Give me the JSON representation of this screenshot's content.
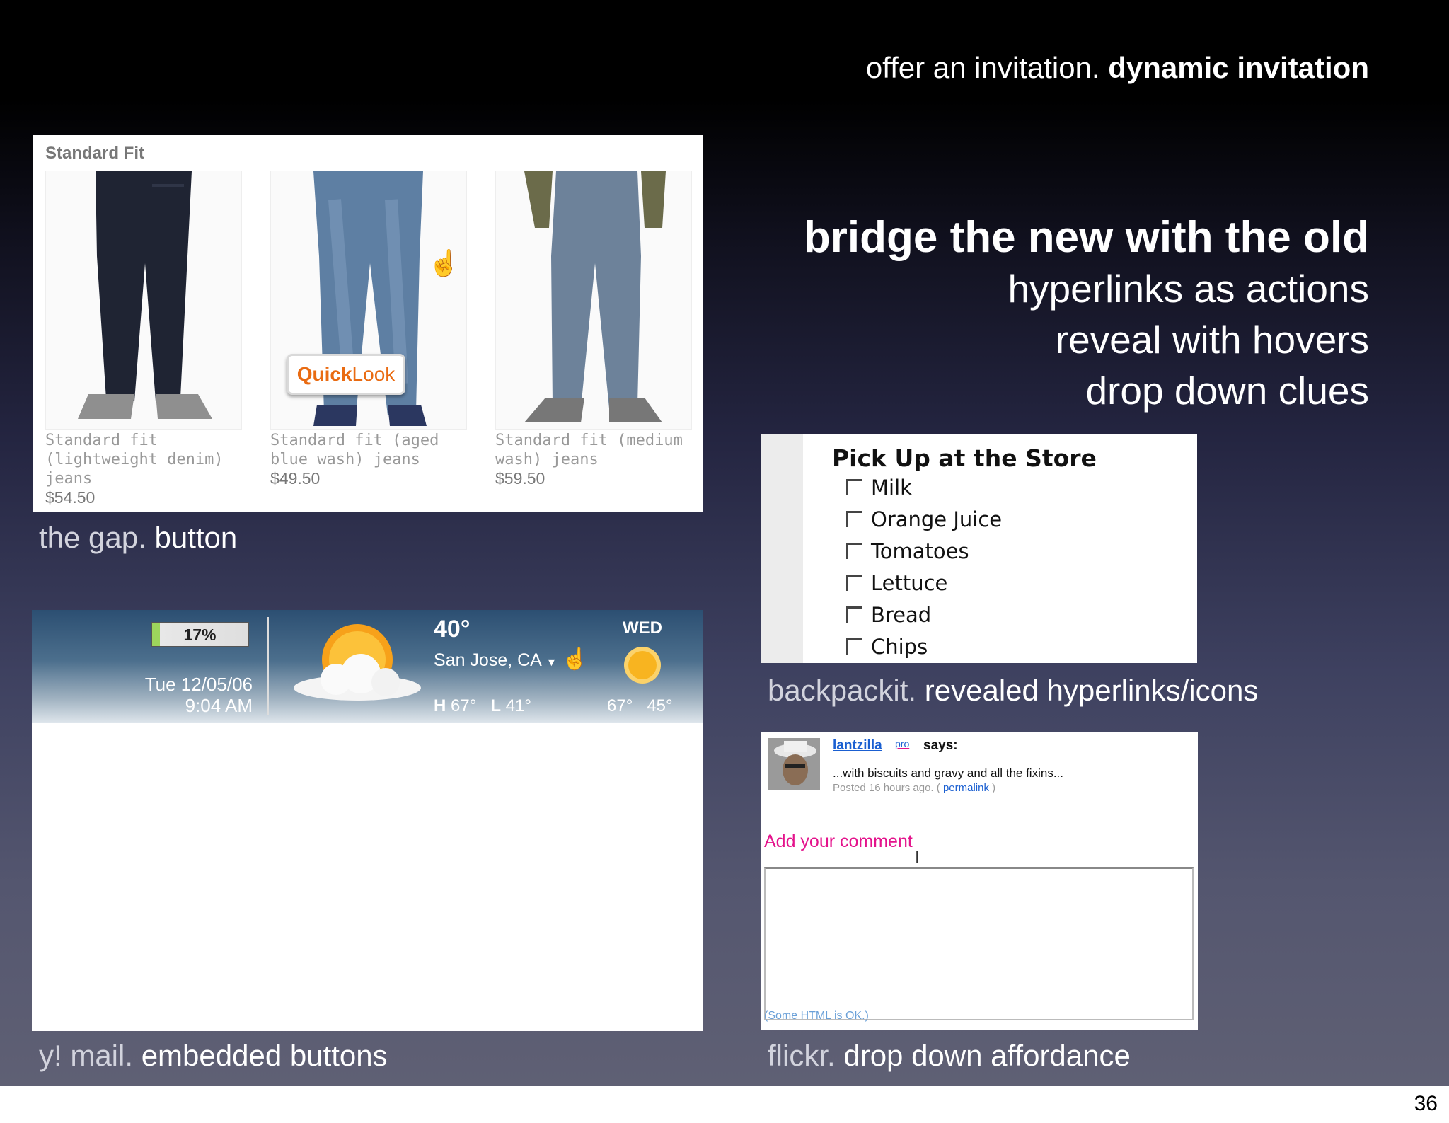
{
  "slide": {
    "header_light": "offer an invitation.",
    "header_bold": "dynamic invitation",
    "headline": "bridge the new with the old",
    "points": [
      "hyperlinks as actions",
      "reveal with hovers",
      "drop down clues"
    ],
    "page_number": "36"
  },
  "gap": {
    "title": "Standard Fit",
    "quicklook_left": "Quick",
    "quicklook_right": "Look",
    "products": [
      {
        "name": "Standard fit (lightweight denim) jeans",
        "price": "$54.50"
      },
      {
        "name": "Standard fit (aged blue wash) jeans",
        "price": "$49.50"
      },
      {
        "name": "Standard fit (medium wash) jeans",
        "price": "$59.50"
      }
    ],
    "caption_light": "the gap.",
    "caption_bold": "button"
  },
  "weather": {
    "progress_label": "17%",
    "progress_value": 0.17,
    "date": "Tue 12/05/06",
    "time": "9:04 AM",
    "temperature": "40°",
    "location": "San Jose, CA",
    "high_label": "H",
    "high": "67°",
    "low_label": "L",
    "low": "41°",
    "day": "WED",
    "day_high": "67°",
    "day_low": "45°",
    "caption_light": "y! mail.",
    "caption_bold": "embedded buttons"
  },
  "backpackit": {
    "title": "Pick Up at the Store",
    "items": [
      "Milk",
      "Orange Juice",
      "Tomatoes",
      "Lettuce",
      "Bread",
      "Chips"
    ],
    "caption_light": "backpackit.",
    "caption_bold": "revealed hyperlinks/icons"
  },
  "flickr": {
    "username": "lantzilla",
    "pro": "pro",
    "says": "says:",
    "comment": "...with biscuits and gravy and all the fixins...",
    "posted": "Posted 16 hours ago. (",
    "permalink": "permalink",
    "posted_end": ")",
    "add_comment": "Add your comment",
    "html_ok": "(Some HTML is OK.)",
    "caption_light": "flickr.",
    "caption_bold": "drop down affordance"
  },
  "colors": {
    "quicklook_orange": "#e96b12",
    "flickr_pink": "#e4138c",
    "flickr_blue": "#1a5fd1"
  }
}
